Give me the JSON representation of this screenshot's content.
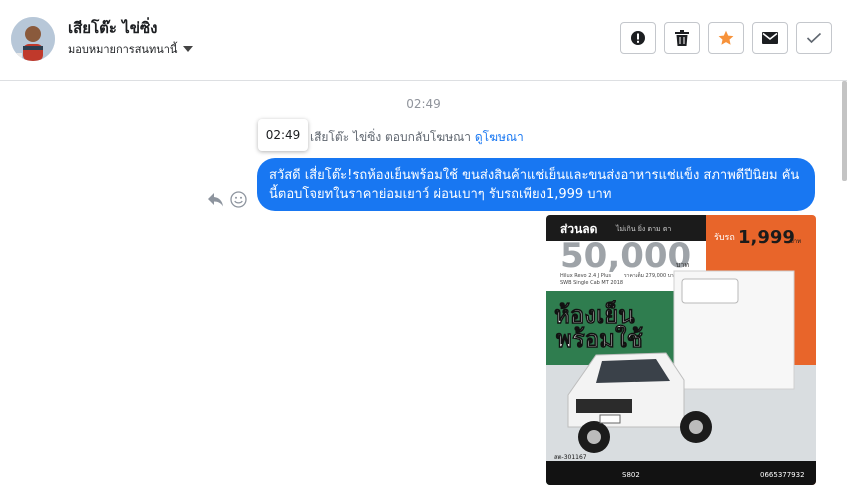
{
  "header": {
    "contact_name": "เสียโต๊ะ ไข่ซิ่ง",
    "assign_label": "มอบหมายการสนทนานี้",
    "actions": {
      "spam": "exclamation-icon",
      "delete": "trash-icon",
      "star": "star-icon",
      "unread": "envelope-icon",
      "done": "check-icon"
    },
    "star_color": "#f7923a"
  },
  "thread": {
    "timestamp": "02:49",
    "tooltip": "02:49",
    "reply_prefix": "เสียโต๊ะ ไข่ซิ่ง ตอบกลับโฆษณา",
    "reply_link": "ดูโฆษณา",
    "message": "สวัสดี เสี่ยโต๊ะ!รถห้องเย็นพร้อมใช้ ขนส่งสินค้าแช่เย็นและขนส่งอาหารแช่แข็ง สภาพดีปีนิยม คันนี้ตอบโจยทในราคาย่อมเยาว์ ผ่อนเบาๆ รับรถเพียง1,999 บาท",
    "bubble_color": "#1877f2"
  },
  "ad": {
    "discount_label": "ส่วนลด",
    "discount_sub": "ไม่เกิน ยิ่ง ตาม ตา",
    "discount_amount": "50,000",
    "discount_unit": "บาท",
    "price_label": "รับรถ",
    "price_amount": "1,999",
    "price_unit": "บาท",
    "model_line1": "Hilux Revo 2.4 J Plus",
    "model_line2": "SWB Single Cab MT 2018",
    "price_full": "ราคาเต็ม 279,000 บาท",
    "headline_1": "ห้องเย็น",
    "headline_2": "พร้อมใช้",
    "plate": "สต-301167",
    "footer_code": "S802",
    "footer_phone": "0665377932"
  }
}
